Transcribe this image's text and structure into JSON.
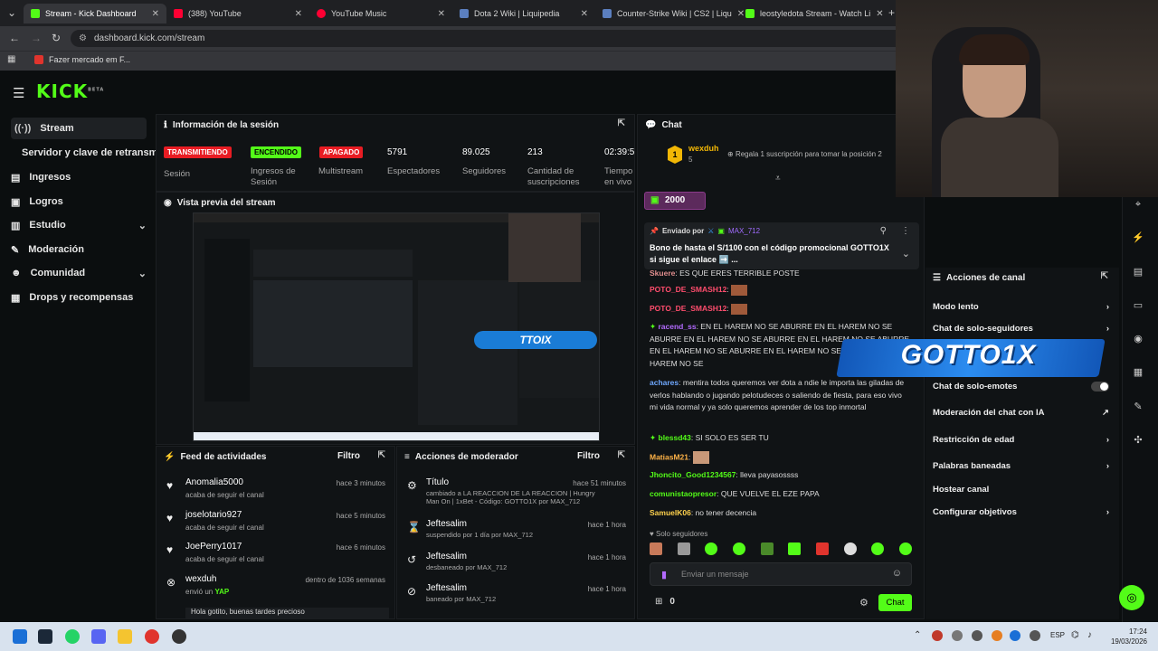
{
  "browser": {
    "tabs": [
      {
        "label": "Stream - Kick Dashboard",
        "color": "#53fc18"
      },
      {
        "label": "(388) YouTube",
        "color": "#ff0033"
      },
      {
        "label": "YouTube Music",
        "color": "#ff0033"
      },
      {
        "label": "Dota 2 Wiki | Liquipedia",
        "color": "#5b7fbf"
      },
      {
        "label": "Counter-Strike Wiki | CS2 | Liqu",
        "color": "#5b7fbf"
      },
      {
        "label": "leostyledota Stream - Watch Li",
        "color": "#53fc18"
      }
    ],
    "url": "dashboard.kick.com/stream",
    "bookmark": "Fazer mercado em F..."
  },
  "brand": {
    "logo": "KICK",
    "beta": "BETA",
    "accent": "#53fc18"
  },
  "sidebar": {
    "items": [
      {
        "label": "Stream",
        "icon": "broadcast-icon"
      },
      {
        "label": "Servidor y clave de retransm",
        "icon": ""
      },
      {
        "label": "Ingresos",
        "icon": "money-icon"
      },
      {
        "label": "Logros",
        "icon": "trophy-icon"
      },
      {
        "label": "Estudio",
        "icon": "studio-icon"
      },
      {
        "label": "Moderación",
        "icon": "wrench-icon"
      },
      {
        "label": "Comunidad",
        "icon": "people-icon"
      },
      {
        "label": "Drops y recompensas",
        "icon": "drops-icon"
      }
    ]
  },
  "session": {
    "title": "Información de la sesión",
    "tags": {
      "live": "TRANSMITIENDO",
      "on": "ENCENDIDO",
      "off": "APAGADO"
    },
    "labels": {
      "session": "Sesión",
      "revenue": "Ingresos de Sesión",
      "multi": "Multistream",
      "viewers": "Espectadores",
      "followers": "Seguidores",
      "subs": "Cantidad de suscripciones",
      "uptime": "Tiempo en vivo"
    },
    "values": {
      "viewers": "5791",
      "followers": "89.025",
      "subs": "213",
      "uptime": "02:39:5"
    }
  },
  "preview": {
    "title": "Vista previa del stream",
    "overlay": "TTOIX"
  },
  "feed": {
    "title": "Feed de actividades",
    "filter": "Filtro",
    "rows": [
      {
        "name": "Anomalia5000",
        "sub": "acaba de seguir el canal",
        "time": "hace 3 minutos"
      },
      {
        "name": "joselotario927",
        "sub": "acaba de seguir el canal",
        "time": "hace 5 minutos"
      },
      {
        "name": "JoePerry1017",
        "sub": "acaba de seguir el canal",
        "time": "hace 6 minutos"
      },
      {
        "name": "wexduh",
        "sub": "envió un",
        "sub2": "YAP",
        "time": "dentro de 1036 semanas"
      }
    ],
    "tail": "Hola gotito, buenas tardes precioso"
  },
  "mod": {
    "title": "Acciones de moderador",
    "filter": "Filtro",
    "rows": [
      {
        "name": "Título",
        "sub": "cambiado a LA REACCION DE LA REACCION | Hungry Man On | 1xBet - Código: GOTTO1X por MAX_712",
        "time": "hace 51 minutos"
      },
      {
        "name": "Jeftesalim",
        "sub": "suspendido por 1 día por MAX_712",
        "time": "hace 1 hora"
      },
      {
        "name": "Jeftesalim",
        "sub": "desbaneado por MAX_712",
        "time": "hace 1 hora"
      },
      {
        "name": "Jeftesalim",
        "sub": "baneado por MAX_712",
        "time": "hace 1 hora"
      }
    ]
  },
  "chat": {
    "title": "Chat",
    "top_user": "wexduh",
    "top_count": "5",
    "gift_cta": "Regala 1 suscripción para tomar la posición 2",
    "bits": "2000",
    "pinned_by": "Enviado por",
    "pinned_user": "MAX_712",
    "pinned_text": "Bono de hasta el S/1100 con el código promocional GOTTO1X si sigue el enlace ➡️ ...",
    "messages": [
      {
        "user": "Skuere",
        "text": "ES QUE ERES TERRIBLE POSTE",
        "color": "#e08e8e"
      },
      {
        "user": "POTO_DE_SMASH12",
        "text": "",
        "color": "#ff4d6d"
      },
      {
        "user": "POTO_DE_SMASH12",
        "text": "",
        "color": "#ff4d6d"
      },
      {
        "user": "racend_ss",
        "text": "EN EL HAREM NO SE ABURRE EN EL HAREM NO SE ABURRE EN EL HAREM NO SE ABURRE EN EL HAREM NO SE ABURRE EN EL HAREM NO SE ABURRE EN EL HAREM NO SE ABURRE EN EL HAREM NO SE",
        "color": "#b36bff"
      },
      {
        "user": "achares",
        "text": "mentira todos queremos ver dota a ndie le importa las giladas de verlos hablando o jugando pelotudeces o saliendo de fiesta, para eso vivo mi vida normal y ya solo queremos aprender de los top inmortal",
        "color": "#6fa8ff"
      },
      {
        "user": "blessd43",
        "text": "SI SOLO ES SER TU",
        "color": "#53fc18"
      },
      {
        "user": "MatiasM21",
        "text": "",
        "color": "#ffb347"
      },
      {
        "user": "Jhoncito_Good1234567",
        "text": "lleva payasossss",
        "color": "#53fc18"
      },
      {
        "user": "comunistaopresor",
        "text": "QUE VUELVE EL EZE PAPA",
        "color": "#53fc18"
      },
      {
        "user": "SamuelK06",
        "text": "no tener decencia",
        "color": "#ffd24d"
      }
    ],
    "followers_only": "Solo seguidores",
    "input_placeholder": "Enviar un mensaje",
    "count": "0",
    "send": "Chat"
  },
  "channel_actions": {
    "title": "Acciones de canal",
    "items": [
      "Modo lento",
      "Chat de solo-seguidores",
      "Chat de solo-emotes",
      "Moderación del chat con IA",
      "Restricción de edad",
      "Palabras baneadas",
      "Hostear canal",
      "Configurar objetivos"
    ],
    "overlay_text": "GOTTO1X"
  },
  "taskbar": {
    "lang": "ESP",
    "time": "17:24",
    "date": "19/03/2026"
  }
}
